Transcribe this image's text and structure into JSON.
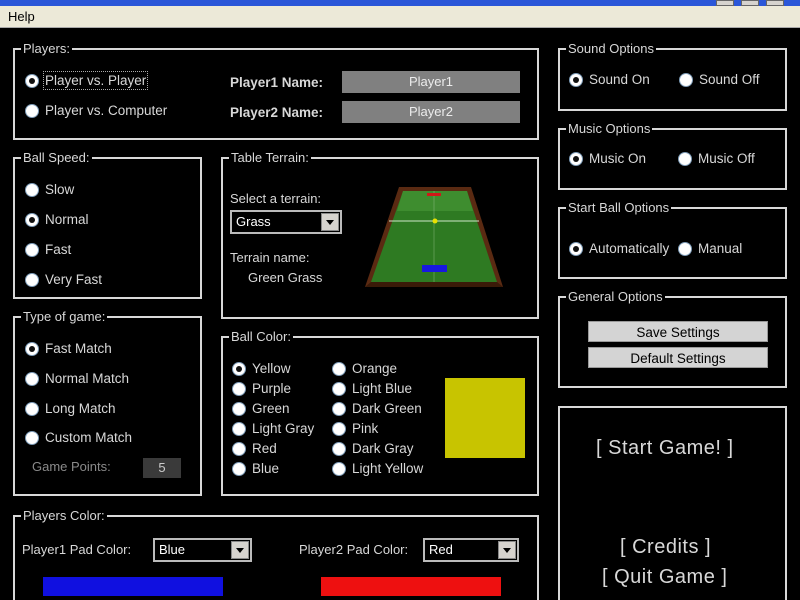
{
  "menubar": {
    "help": "Help"
  },
  "players": {
    "legend": "Players:",
    "options": [
      "Player vs. Player",
      "Player vs. Computer"
    ],
    "selected": 0,
    "player1_label": "Player1 Name:",
    "player1_value": "Player1",
    "player2_label": "Player2 Name:",
    "player2_value": "Player2"
  },
  "ball_speed": {
    "legend": "Ball Speed:",
    "options": [
      "Slow",
      "Normal",
      "Fast",
      "Very Fast"
    ],
    "selected": 1
  },
  "table_terrain": {
    "legend": "Table Terrain:",
    "select_label": "Select a terrain:",
    "select_value": "Grass",
    "name_label": "Terrain name:",
    "name_value": "Green Grass"
  },
  "type_of_game": {
    "legend": "Type of game:",
    "options": [
      "Fast Match",
      "Normal Match",
      "Long Match",
      "Custom Match"
    ],
    "selected": 0,
    "points_label": "Game Points:",
    "points_value": "5"
  },
  "ball_color": {
    "legend": "Ball Color:",
    "options_left": [
      "Yellow",
      "Purple",
      "Green",
      "Light Gray",
      "Red",
      "Blue"
    ],
    "options_right": [
      "Orange",
      "Light Blue",
      "Dark Green",
      "Pink",
      "Dark Gray",
      "Light Yellow"
    ],
    "selected": "Yellow",
    "preview_color": "#c8c400"
  },
  "players_color": {
    "legend": "Players Color:",
    "p1_label": "Player1 Pad Color:",
    "p1_value": "Blue",
    "p1_color": "#1010e0",
    "p2_label": "Player2 Pad Color:",
    "p2_value": "Red",
    "p2_color": "#ee1010"
  },
  "sound": {
    "legend": "Sound Options",
    "on": "Sound On",
    "off": "Sound Off",
    "selected": "on"
  },
  "music": {
    "legend": "Music Options",
    "on": "Music On",
    "off": "Music Off",
    "selected": "on"
  },
  "start_ball": {
    "legend": "Start Ball Options",
    "auto": "Automatically",
    "manual": "Manual",
    "selected": "auto"
  },
  "general": {
    "legend": "General Options",
    "save": "Save Settings",
    "default": "Default Settings"
  },
  "actions": {
    "start": "[ Start Game! ]",
    "credits": "[ Credits ]",
    "quit": "[ Quit Game ]"
  }
}
